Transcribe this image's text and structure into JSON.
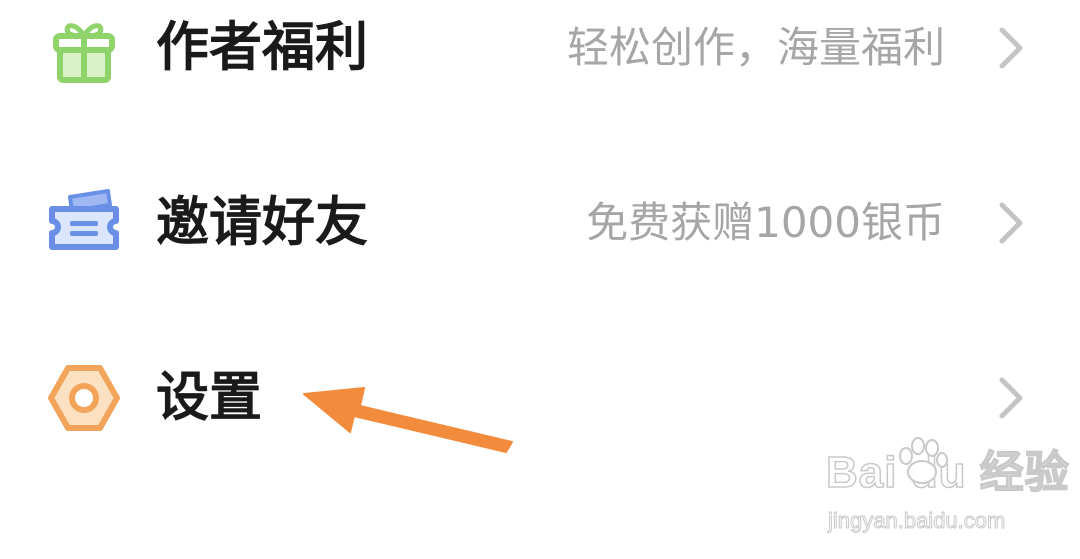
{
  "menu": {
    "items": [
      {
        "icon": "gift-icon",
        "title": "作者福利",
        "description": "轻松创作，海量福利",
        "icon_color": "#8fd36b"
      },
      {
        "icon": "ticket-icon",
        "title": "邀请好友",
        "description": "免费获赠1000银币",
        "icon_color": "#6a8fe6"
      },
      {
        "icon": "settings-hexagon-icon",
        "title": "设置",
        "description": "",
        "icon_color": "#f2a55a"
      }
    ]
  },
  "annotation": {
    "icon": "pointer-arrow-icon",
    "color": "#f28c3c"
  },
  "watermark": {
    "brand": "Bai du 经验",
    "url": "jingyan.baidu.com"
  }
}
